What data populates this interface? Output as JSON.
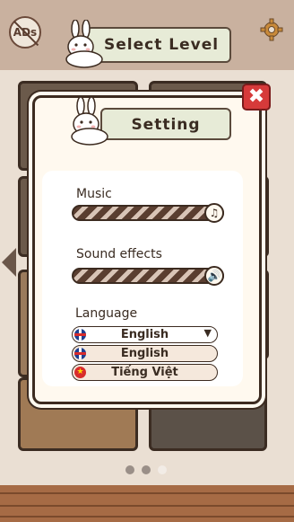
{
  "header": {
    "ads_label": "ADs",
    "title": "Select Level"
  },
  "icons": {
    "gear": "gear-icon",
    "rabbit": "rabbit-icon",
    "music_note": "music-note-icon",
    "speaker": "speaker-icon",
    "close": "close-icon"
  },
  "settings": {
    "title": "Setting",
    "close_label": "✖",
    "music_label": "Music",
    "music_level": 1.0,
    "sound_label": "Sound effects",
    "sound_level": 1.0,
    "language_label": "Language",
    "selected_language": "English",
    "languages": [
      "English",
      "Tiếng Việt"
    ]
  },
  "pager": {
    "pages": 3,
    "active": 3
  },
  "colors": {
    "close": "#d63a3a",
    "pill": "#e7ebd7",
    "frame": "#3c2b20"
  }
}
